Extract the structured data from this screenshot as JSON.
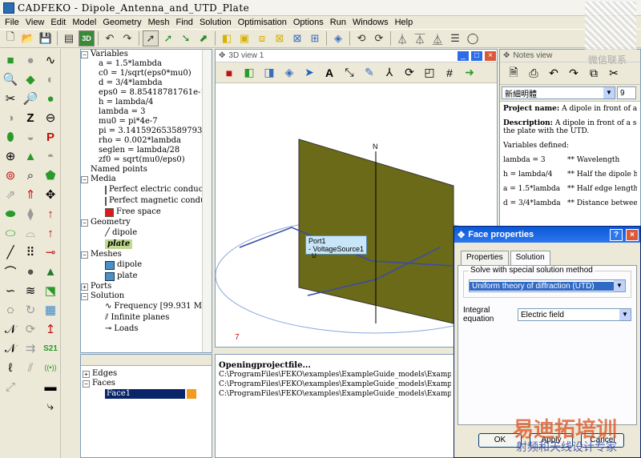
{
  "app": {
    "title": "CADFEKO - Dipole_Antenna_and_UTD_Plate"
  },
  "menu": [
    "File",
    "View",
    "Edit",
    "Model",
    "Geometry",
    "Mesh",
    "Find",
    "Solution",
    "Optimisation",
    "Options",
    "Run",
    "Windows",
    "Help"
  ],
  "tree": {
    "variables_label": "Variables",
    "variables": [
      "a = 1.5*lambda",
      "c0 = 1/sqrt(eps0*mu0)",
      "d = 3/4*lambda",
      "eps0 = 8.85418781761e-12",
      "h = lambda/4",
      "lambda = 3",
      "mu0 = pi*4e-7",
      "pi = 3.14159265358979323846",
      "rho = 0.002*lambda",
      "seglen = lambda/28",
      "zf0 = sqrt(mu0/eps0)"
    ],
    "named_points": "Named points",
    "media_label": "Media",
    "media": [
      {
        "label": "Perfect electric conductor",
        "color": "#f39a1f"
      },
      {
        "label": "Perfect magnetic conductor",
        "color": "#2a7fd4"
      },
      {
        "label": "Free space",
        "color": "#e01818"
      }
    ],
    "geometry_label": "Geometry",
    "geometry": [
      "dipole",
      "plate"
    ],
    "meshes_label": "Meshes",
    "meshes": [
      "dipole",
      "plate"
    ],
    "ports_label": "Ports",
    "solution_label": "Solution",
    "solution": [
      "Frequency [99.931 MHz]",
      "Infinite planes",
      "Loads"
    ]
  },
  "faces_tree": {
    "edges": "Edges",
    "faces": "Faces",
    "face1": "Face1"
  },
  "view3d": {
    "title": "3D view 1",
    "axis_n": "N",
    "port_label": "Port1",
    "source_label": "- VoltageSource1",
    "axis_u": "U",
    "marker_7": "7",
    "plate_color": "#6b6a18"
  },
  "output": {
    "heading": "Openingprojectfile...",
    "lines": [
      "C:\\ProgramFiles\\FEKO\\examples\\ExampleGuide_models\\Example16-Dipole_An",
      "C:\\ProgramFiles\\FEKO\\examples\\ExampleGuide_models\\Example16-Dipole_An",
      "C:\\ProgramFiles\\FEKO\\examples\\ExampleGuide_models\\Example16-Dipole_An"
    ]
  },
  "notes": {
    "title": "Notes view",
    "font": "新細明體",
    "size": "9",
    "project_name_label": "Project name:",
    "project_name": "A dipole in front of a squar",
    "description_label": "Description:",
    "description": "A dipole in front of a square",
    "description2": "the plate with the UTD.",
    "variables_defined": "Variables defined:",
    "vars": [
      {
        "v": "lambda = 3",
        "c": "** Wavelength"
      },
      {
        "v": "h = lambda/4",
        "c": "** Half the dipole hei"
      },
      {
        "v": "a = 1.5*lambda",
        "c": "** Half edge length o"
      },
      {
        "v": "d = 3/4*lambda",
        "c": "** Distance between d"
      }
    ]
  },
  "dialog": {
    "title": "Face properties",
    "tabs": [
      "Properties",
      "Solution"
    ],
    "group_label": "Solve with special solution method",
    "method": "Uniform theory of diffraction (UTD)",
    "ie_label": "Integral equation",
    "ie_value": "Electric field",
    "buttons": [
      "OK",
      "Apply",
      "Cancel"
    ]
  },
  "watermark": {
    "text1": "微信联系",
    "text2": "易迪拓培训",
    "text3": "射频和天线设计专家"
  }
}
